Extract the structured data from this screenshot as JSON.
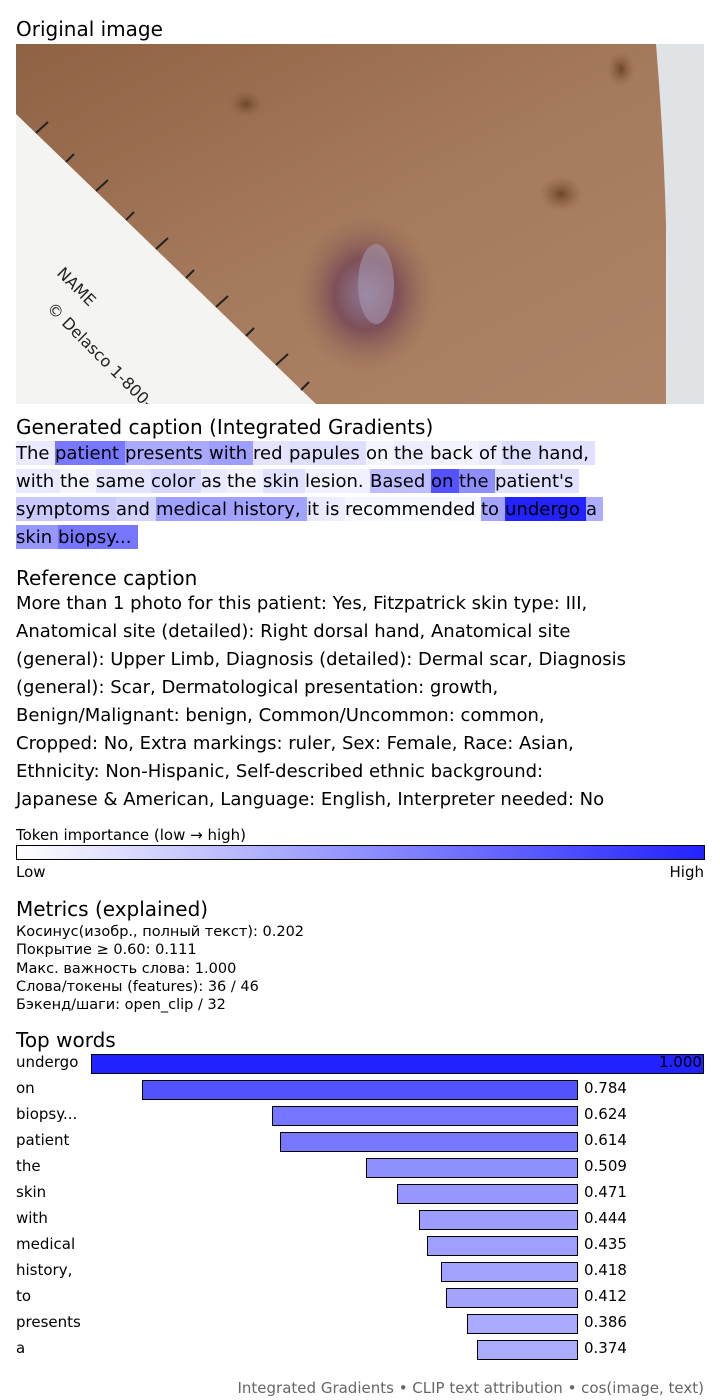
{
  "sections": {
    "original_title": "Original image",
    "generated_title": "Generated caption (Integrated Gradients)",
    "reference_title": "Reference caption",
    "metrics_title": "Metrics (explained)",
    "top_words_title": "Top words"
  },
  "photo": {
    "ruler_text_1": "NAME",
    "ruler_text_2": "© Delasco 1-800-"
  },
  "generated_caption": {
    "lines": [
      {
        "tokens": [
          {
            "text": "The",
            "w": 0.1
          },
          {
            "text": "patient",
            "w": 0.61
          },
          {
            "text": "presents",
            "w": 0.39
          },
          {
            "text": "with",
            "w": 0.44
          },
          {
            "text": "red",
            "w": 0.12
          },
          {
            "text": "papules",
            "w": 0.15
          },
          {
            "text": "on",
            "w": 0.05
          },
          {
            "text": "the",
            "w": 0.08
          },
          {
            "text": "back",
            "w": 0.06
          },
          {
            "text": "of",
            "w": 0.09
          },
          {
            "text": "the",
            "w": 0.16
          },
          {
            "text": "hand,",
            "w": 0.14
          }
        ]
      },
      {
        "tokens": [
          {
            "text": "with",
            "w": 0.1
          },
          {
            "text": "the",
            "w": 0.05
          },
          {
            "text": "same",
            "w": 0.12
          },
          {
            "text": "color",
            "w": 0.18
          },
          {
            "text": "as",
            "w": 0.1
          },
          {
            "text": "the",
            "w": 0.06
          },
          {
            "text": "skin",
            "w": 0.14
          },
          {
            "text": "lesion.",
            "w": 0.07
          },
          {
            "text": "Based",
            "w": 0.3
          },
          {
            "text": "on",
            "w": 0.78
          },
          {
            "text": "the",
            "w": 0.51
          },
          {
            "text": "patient's",
            "w": 0.14
          }
        ]
      },
      {
        "tokens": [
          {
            "text": "symptoms",
            "w": 0.24
          },
          {
            "text": "and",
            "w": 0.2
          },
          {
            "text": "medical",
            "w": 0.43
          },
          {
            "text": "history,",
            "w": 0.42
          },
          {
            "text": "it",
            "w": 0.1
          },
          {
            "text": "is",
            "w": 0.08
          },
          {
            "text": "recommended",
            "w": 0.04
          },
          {
            "text": "to",
            "w": 0.41
          },
          {
            "text": "undergo",
            "w": 1.0
          },
          {
            "text": "a",
            "w": 0.37
          }
        ]
      },
      {
        "tokens": [
          {
            "text": "skin",
            "w": 0.47
          },
          {
            "text": "biopsy...",
            "w": 0.62
          }
        ]
      }
    ]
  },
  "reference_caption": {
    "lines": [
      "More than 1 photo for this patient: Yes, Fitzpatrick skin type: III,",
      "Anatomical site (detailed): Right dorsal hand, Anatomical site",
      "(general): Upper Limb, Diagnosis (detailed): Dermal scar, Diagnosis",
      "(general): Scar, Dermatological presentation: growth,",
      "Benign/Malignant: benign, Common/Uncommon: common,",
      "Cropped: No, Extra markings: ruler, Sex: Female, Race: Asian,",
      "Ethnicity: Non-Hispanic, Self-described ethnic background:",
      "Japanese & American, Language: English, Interpreter needed: No"
    ]
  },
  "legend": {
    "title": "Token importance (low → high)",
    "low": "Low",
    "high": "High",
    "color_low": "#ffffff",
    "color_high": "#2222ff"
  },
  "metrics": {
    "lines": [
      "Косинус(изобр., полный текст): 0.202",
      "Покрытие ≥ 0.60: 0.111",
      "Макс. важность слова: 1.000",
      "Слова/токены (features): 36 / 46",
      "Бэкенд/шаги: open_clip / 32"
    ]
  },
  "chart_data": {
    "type": "bar",
    "orientation": "horizontal",
    "categories": [
      "undergo",
      "on",
      "biopsy...",
      "patient",
      "the",
      "skin",
      "with",
      "medical",
      "history,",
      "to",
      "presents",
      "a"
    ],
    "values": [
      1.0,
      0.784,
      0.624,
      0.614,
      0.509,
      0.471,
      0.444,
      0.435,
      0.418,
      0.412,
      0.386,
      0.374
    ],
    "value_labels": [
      "1.000",
      "0.784",
      "0.624",
      "0.614",
      "0.509",
      "0.471",
      "0.444",
      "0.435",
      "0.418",
      "0.412",
      "0.386",
      "0.374"
    ],
    "xlim": [
      0,
      1
    ],
    "grid": false
  },
  "footer": "Integrated Gradients • CLIP text attribution • cos(image, text)"
}
